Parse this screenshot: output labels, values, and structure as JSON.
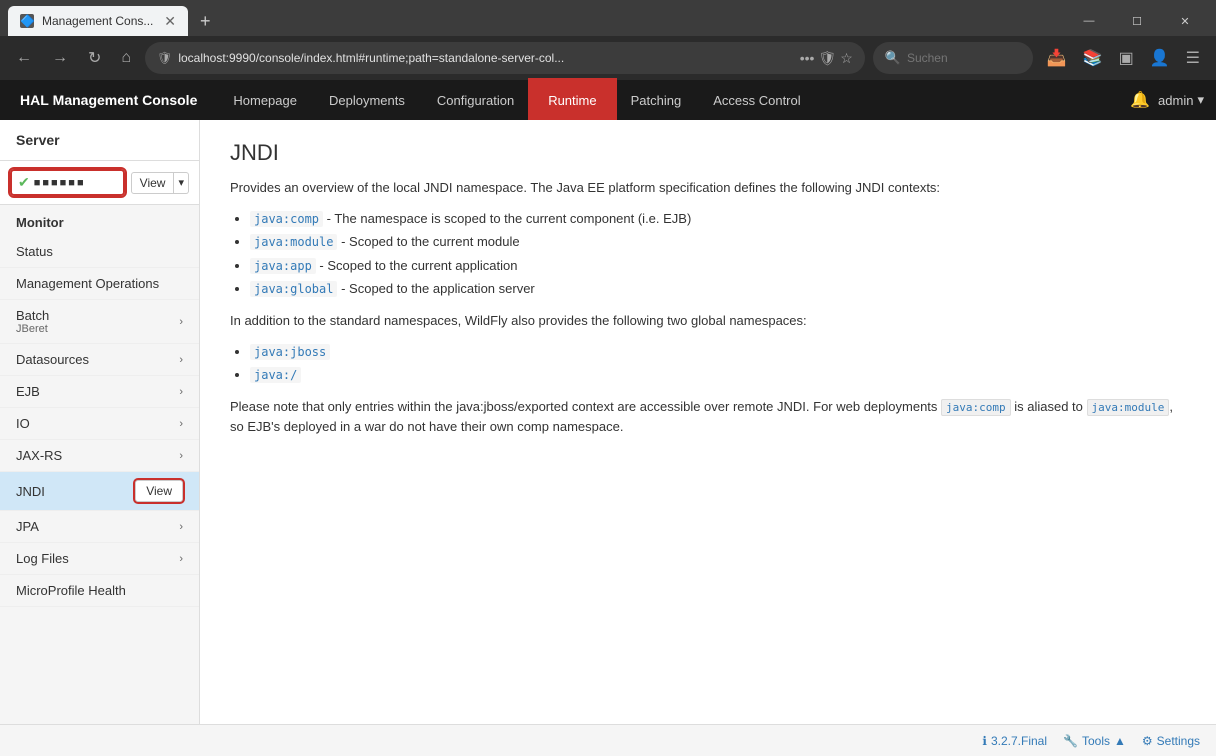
{
  "browser": {
    "tab_title": "Management Cons...",
    "tab_favicon": "🔷",
    "url": "localhost:9990/console/index.html#runtime;path=standalone-server-col...",
    "search_placeholder": "Suchen",
    "new_tab_label": "+",
    "minimize": "—",
    "maximize": "☐",
    "close": "✕"
  },
  "app": {
    "logo": "HAL Management Console",
    "logo_hal": "HAL",
    "logo_rest": " Management Console"
  },
  "nav": {
    "items": [
      {
        "label": "Homepage",
        "active": false
      },
      {
        "label": "Deployments",
        "active": false
      },
      {
        "label": "Configuration",
        "active": false
      },
      {
        "label": "Runtime",
        "active": true
      },
      {
        "label": "Patching",
        "active": false
      },
      {
        "label": "Access Control",
        "active": false
      }
    ],
    "user": "admin",
    "bell": "🔔"
  },
  "sidebar": {
    "server_header": "Server",
    "server_name": "●●●●●●",
    "server_status": "●",
    "view_button": "View",
    "view_dropdown": "▾",
    "monitor_header": "Monitor",
    "items": [
      {
        "label": "Status",
        "has_chevron": false,
        "sub": ""
      },
      {
        "label": "Management Operations",
        "has_chevron": false,
        "sub": ""
      },
      {
        "label": "Batch",
        "has_chevron": true,
        "sub": "JBeret"
      },
      {
        "label": "Datasources",
        "has_chevron": true,
        "sub": ""
      },
      {
        "label": "EJB",
        "has_chevron": true,
        "sub": ""
      },
      {
        "label": "IO",
        "has_chevron": true,
        "sub": ""
      },
      {
        "label": "JAX-RS",
        "has_chevron": true,
        "sub": ""
      },
      {
        "label": "JNDI",
        "has_chevron": false,
        "sub": "",
        "active": true,
        "has_view": true
      },
      {
        "label": "JPA",
        "has_chevron": true,
        "sub": ""
      },
      {
        "label": "Log Files",
        "has_chevron": true,
        "sub": ""
      },
      {
        "label": "MicroProfile Health",
        "has_chevron": false,
        "sub": ""
      }
    ]
  },
  "main": {
    "title": "JNDI",
    "desc1": "Provides an overview of the local JNDI namespace. The Java EE platform specification defines the following JNDI contexts:",
    "list1": [
      "java:comp - The namespace is scoped to the current component (i.e. EJB)",
      "java:module - Scoped to the current module",
      "java:app - Scoped to the current application",
      "java:global - Scoped to the application server"
    ],
    "desc2": "In addition to the standard namespaces, WildFly also provides the following two global namespaces:",
    "list2": [
      "java:jboss",
      "java:/"
    ],
    "desc3_before": "Please note that only entries within the java:jboss/exported context are accessible over remote JNDI. For web deployments ",
    "desc3_code1": "java:comp",
    "desc3_mid": " is aliased to ",
    "desc3_code2": "java:module",
    "desc3_after": ", so EJB's deployed in a war do not have their own comp namespace.",
    "list1_codes": [
      "java:comp",
      "java:module",
      "java:app",
      "java:global"
    ],
    "list2_codes": [
      "java:jboss",
      "java:/"
    ]
  },
  "footer": {
    "version": "3.2.7.Final",
    "tools": "Tools",
    "settings": "Settings"
  }
}
